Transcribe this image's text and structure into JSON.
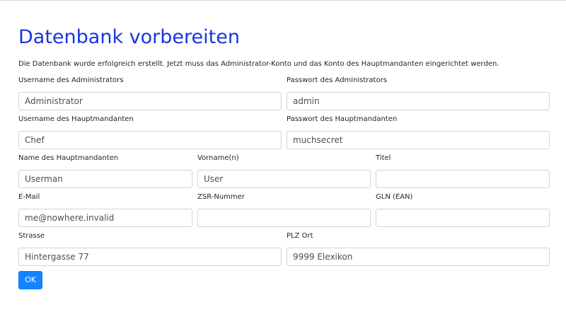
{
  "title": "Datenbank vorbereiten",
  "intro": "Die Datenbank wurde erfolgreich erstellt. Jetzt muss das Administrator-Konto und das Konto des Hauptmandanten eingerichtet werden.",
  "fields": {
    "admin_username": {
      "label": "Username des Administrators",
      "value": "Administrator"
    },
    "admin_password": {
      "label": "Passwort des Administrators",
      "value": "admin"
    },
    "main_username": {
      "label": "Username des Hauptmandanten",
      "value": "Chef"
    },
    "main_password": {
      "label": "Passwort des Hauptmandanten",
      "value": "muchsecret"
    },
    "name": {
      "label": "Name des Hauptmandanten",
      "value": "Userman"
    },
    "firstname": {
      "label": "Vorname(n)",
      "value": "User"
    },
    "title": {
      "label": "Titel",
      "value": ""
    },
    "email": {
      "label": "E-Mail",
      "value": "me@nowhere.invalid"
    },
    "zsr": {
      "label": "ZSR-Nummer",
      "value": ""
    },
    "gln": {
      "label": "GLN (EAN)",
      "value": ""
    },
    "street": {
      "label": "Strasse",
      "value": "Hintergasse 77"
    },
    "zip_city": {
      "label": "PLZ Ort",
      "value": "9999 Elexikon"
    }
  },
  "ok_label": "OK",
  "colors": {
    "title": "#1a35e0",
    "primary_button": "#1284ff",
    "input_border": "#ced4da"
  }
}
